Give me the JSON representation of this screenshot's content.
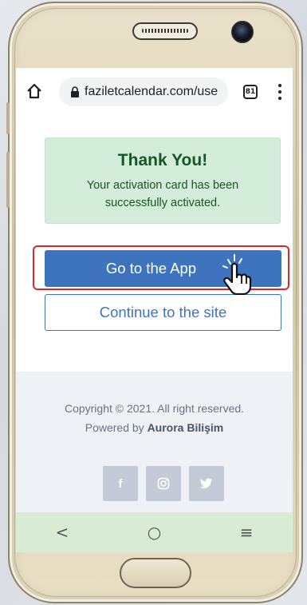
{
  "browser": {
    "url": "faziletcalendar.com/use",
    "tab_count": "81"
  },
  "alert": {
    "title": "Thank You!",
    "message": "Your activation card has been successfully activated."
  },
  "buttons": {
    "go_to_app": "Go to the App",
    "continue_site": "Continue to the site"
  },
  "footer": {
    "copyright": "Copyright © 2021. All right reserved.",
    "powered_prefix": "Powered by",
    "powered_brand": "Aurora Bilişim",
    "socials": [
      {
        "icon": "facebook-icon",
        "glyph": "f"
      },
      {
        "icon": "instagram-icon",
        "glyph": "◎"
      },
      {
        "icon": "twitter-icon",
        "glyph": "🐦"
      }
    ]
  },
  "navbar": {
    "back_glyph": "<",
    "home_glyph": "○",
    "recents_glyph": "≡"
  },
  "colors": {
    "primary": "#3d74bd",
    "alert_bg": "#d4edda",
    "alert_text": "#155724",
    "highlight": "#e0262b",
    "phone_gold": "#d9ceb0"
  }
}
